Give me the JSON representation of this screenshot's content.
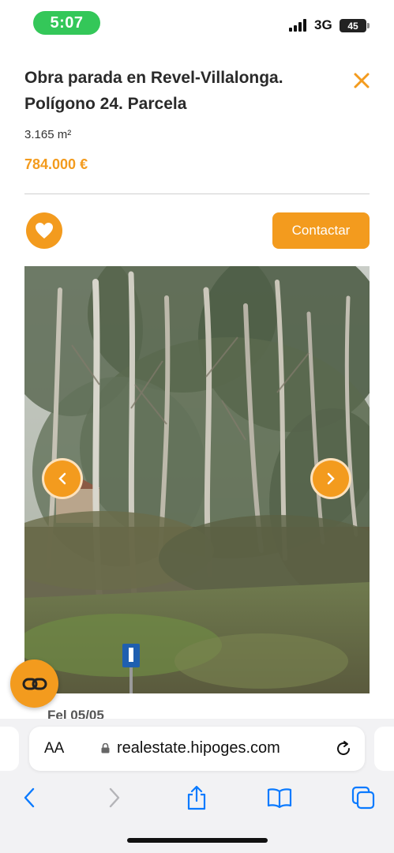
{
  "status": {
    "time": "5:07",
    "network": "3G",
    "battery": "45"
  },
  "listing": {
    "title": "Obra parada en Revel-Villalonga. Polígono 24. Parcela",
    "area": "3.165 m²",
    "price": "784.000 €",
    "contact_label": "Contactar",
    "cutoff_text": "Fel          05/05"
  },
  "browser": {
    "aa_label": "AA",
    "url": "realestate.hipoges.com"
  },
  "colors": {
    "accent": "#f39b1e",
    "status_pill": "#34c759",
    "ios_blue": "#0a7aff"
  },
  "icons": [
    "close-icon",
    "heart-icon",
    "chevron-left-icon",
    "chevron-right-icon",
    "link-icon",
    "lock-icon",
    "reload-icon",
    "back-icon",
    "forward-icon",
    "share-icon",
    "bookmarks-icon",
    "tabs-icon"
  ]
}
